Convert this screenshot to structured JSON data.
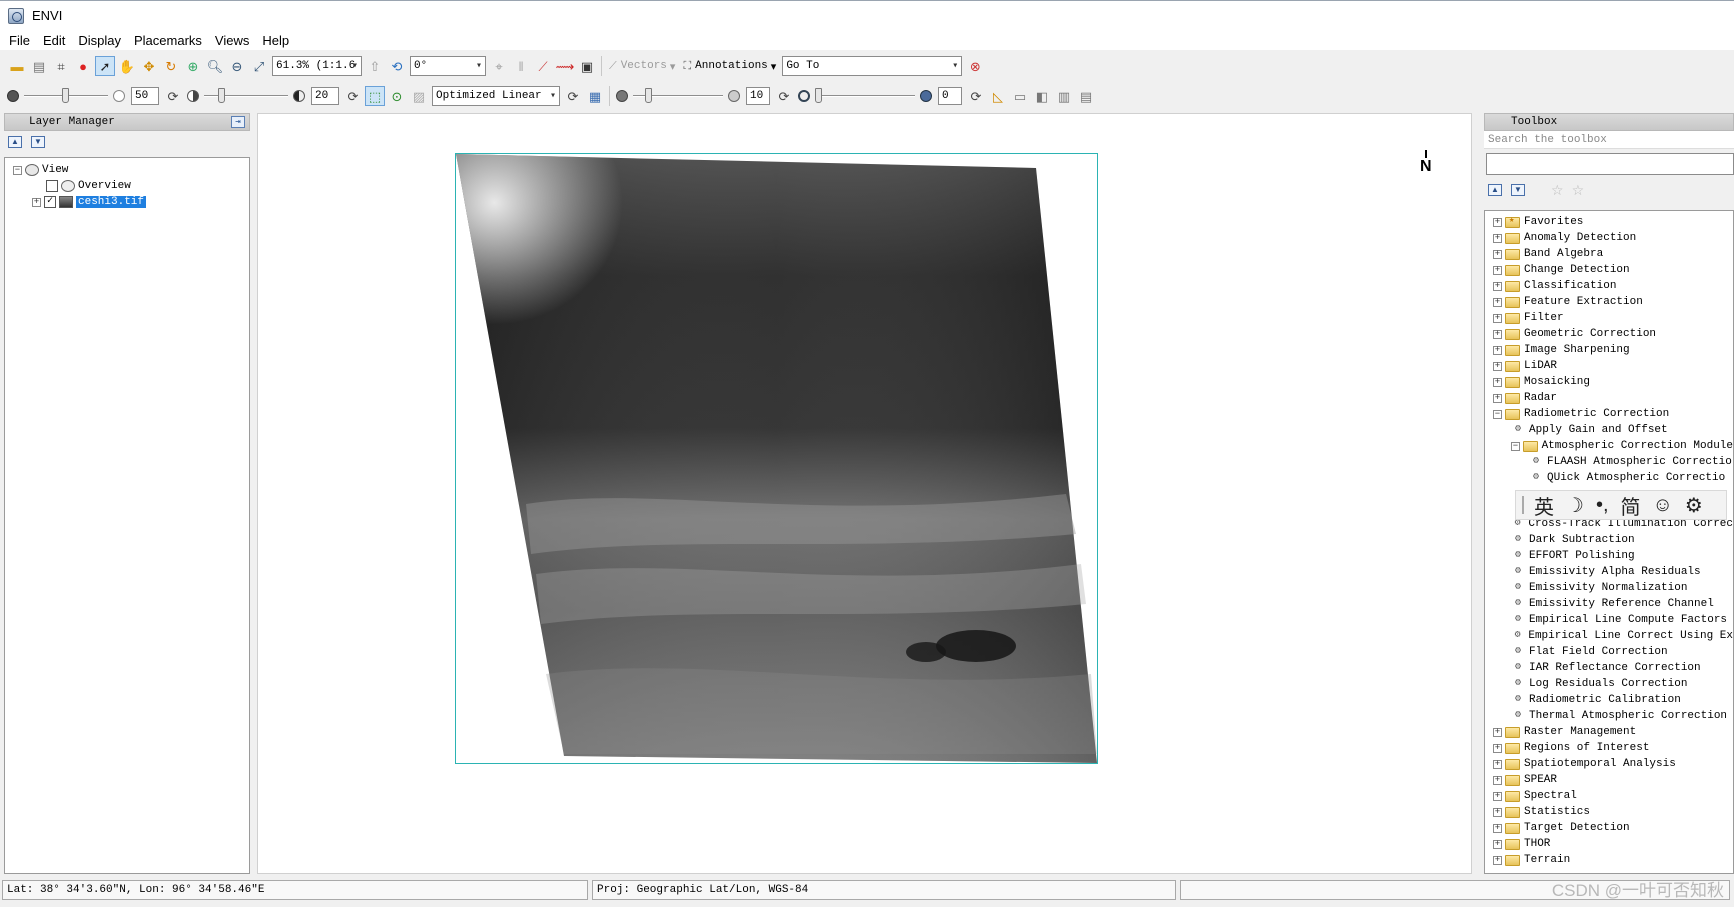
{
  "window": {
    "title": "ENVI"
  },
  "menu": [
    "File",
    "Edit",
    "Display",
    "Placemarks",
    "Views",
    "Help"
  ],
  "toolbar1": {
    "zoom_value": "61.3% (1:1.6",
    "rotation_value": "0°",
    "vectors_label": "Vectors",
    "annotations_label": "Annotations",
    "goto_value": "Go To"
  },
  "toolbar2": {
    "brightness_value": "50",
    "contrast_value": "20",
    "stretch_value": "Optimized Linear",
    "sharpen_value": "10",
    "transparency_value": "0"
  },
  "layer_manager": {
    "title": "Layer Manager",
    "root": "View",
    "items": [
      "Overview",
      "ceshi3.tif"
    ]
  },
  "map_view": {
    "north_label": "N"
  },
  "toolbox": {
    "title": "Toolbox",
    "search_placeholder": "Search the toolbox",
    "items_top": [
      "Favorites",
      "Anomaly Detection",
      "Band Algebra",
      "Change Detection",
      "Classification",
      "Feature Extraction",
      "Filter",
      "Geometric Correction",
      "Image Sharpening",
      "LiDAR",
      "Mosaicking",
      "Radar",
      "Radiometric Correction"
    ],
    "radiometric_children": [
      "Apply Gain and Offset",
      "Atmospheric Correction Module"
    ],
    "atmospheric_children": [
      "FLAASH Atmospheric Correctio",
      "QUick Atmospheric Correctio"
    ],
    "radiometric_children_more": [
      "Cross-Track Illumination Correc",
      "Dark Subtraction",
      "EFFORT Polishing",
      "Emissivity Alpha Residuals",
      "Emissivity Normalization",
      "Emissivity Reference Channel",
      "Empirical Line Compute Factors",
      "Empirical Line Correct Using Ex",
      "Flat Field Correction",
      "IAR Reflectance Correction",
      "Log Residuals Correction",
      "Radiometric Calibration",
      "Thermal Atmospheric Correction"
    ],
    "items_bottom": [
      "Raster Management",
      "Regions of Interest",
      "Spatiotemporal Analysis",
      "SPEAR",
      "Spectral",
      "Statistics",
      "Target Detection",
      "THOR",
      "Terrain"
    ]
  },
  "ime_bar": [
    "英",
    "☽",
    "•,",
    "简",
    "☺",
    "⚙"
  ],
  "status": {
    "latlon": "Lat: 38° 34′3.60″N, Lon: 96° 34′58.46″E",
    "proj": "Proj: Geographic Lat/Lon, WGS-84",
    "extra": ""
  },
  "watermark": "CSDN @一叶可否知秋"
}
